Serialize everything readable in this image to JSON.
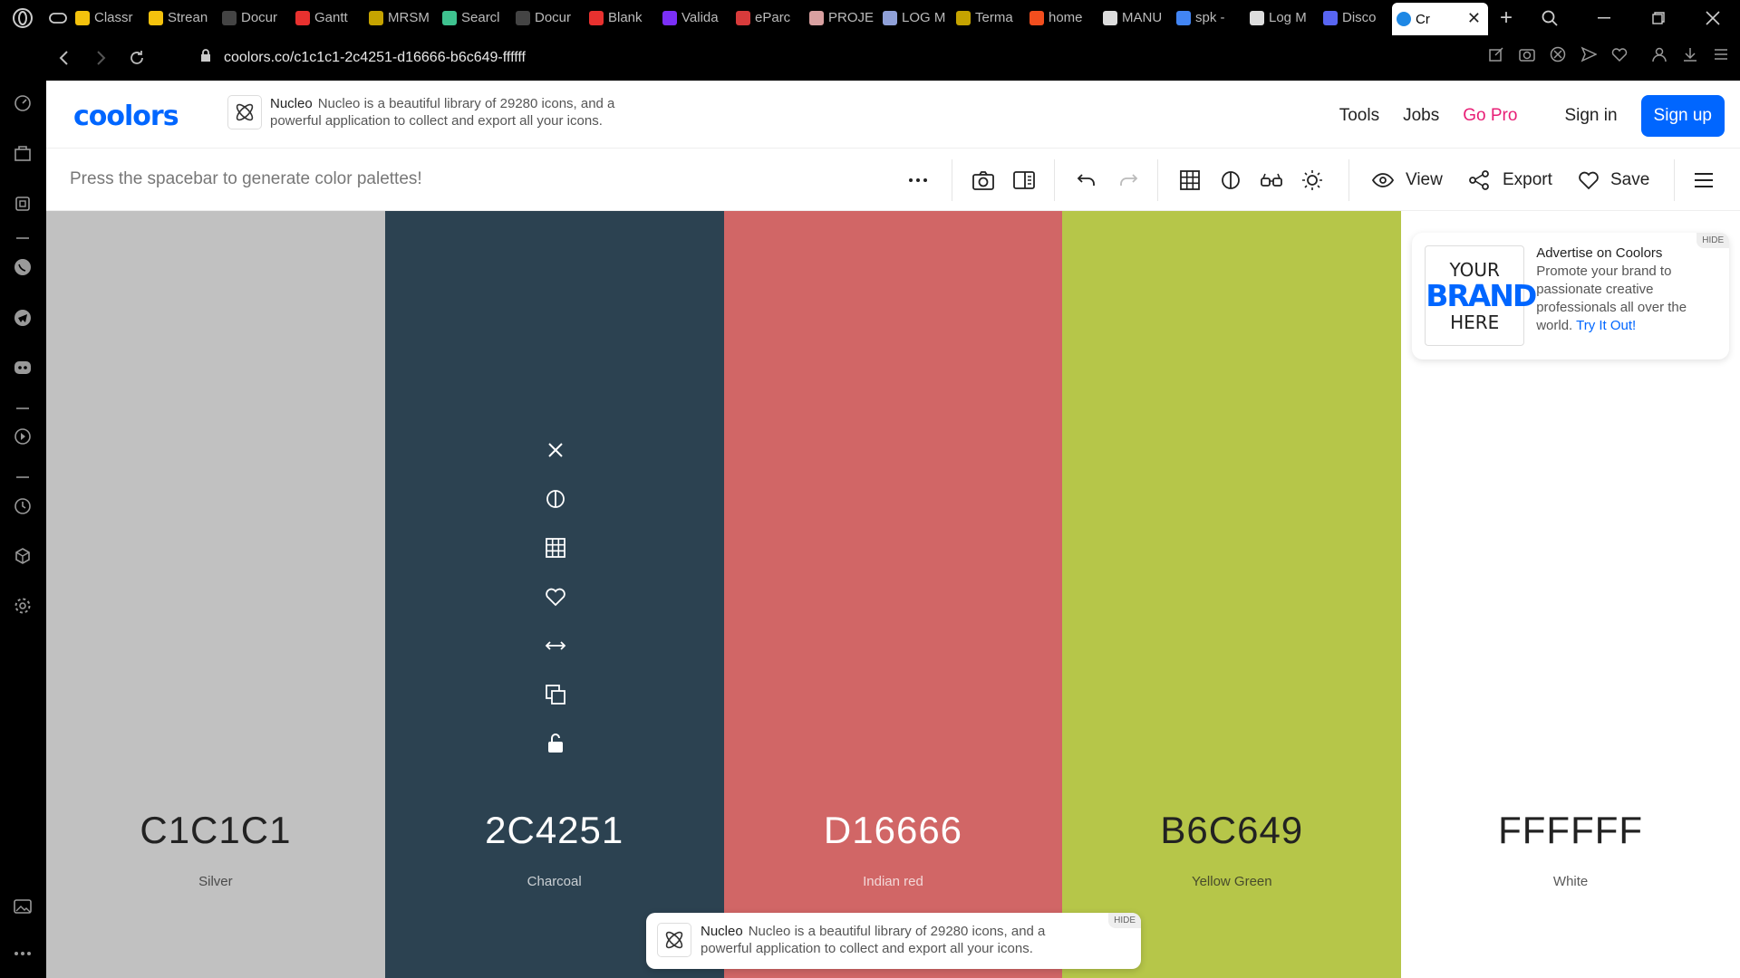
{
  "browser": {
    "tabs": [
      {
        "label": "Classr",
        "color": "#f4c20d"
      },
      {
        "label": "Strean",
        "color": "#f4c20d"
      },
      {
        "label": "Docur",
        "color": "#444444"
      },
      {
        "label": "Gantt",
        "color": "#e8312f"
      },
      {
        "label": "MRSM",
        "color": "#c5a300"
      },
      {
        "label": "Searcl",
        "color": "#3ec28f"
      },
      {
        "label": "Docur",
        "color": "#444444"
      },
      {
        "label": "Blank",
        "color": "#e8312f"
      },
      {
        "label": "Valida",
        "color": "#7b2ff7"
      },
      {
        "label": "eParc",
        "color": "#d83b3b"
      },
      {
        "label": "PROJE",
        "color": "#d9a0a0"
      },
      {
        "label": "LOG M",
        "color": "#8fa0d8"
      },
      {
        "label": "Terma",
        "color": "#c5a300"
      },
      {
        "label": "home",
        "color": "#f24e1e"
      },
      {
        "label": "MANU",
        "color": "#dddddd"
      },
      {
        "label": "spk -",
        "color": "#4285f4"
      },
      {
        "label": "Log M",
        "color": "#dddddd"
      },
      {
        "label": "Disco",
        "color": "#5865f2"
      }
    ],
    "active_tab": {
      "label": "Cr",
      "color": "#1e88e5"
    },
    "new_tab": "+",
    "url": "coolors.co/c1c1c1-2c4251-d16666-b6c649-ffffff"
  },
  "header": {
    "logo": "coolors",
    "ad": {
      "brand": "Nucleo",
      "text": "Nucleo is a beautiful library of 29280 icons, and a powerful application to collect and export all your icons."
    },
    "nav": {
      "tools": "Tools",
      "jobs": "Jobs",
      "gopro": "Go Pro",
      "signin": "Sign in",
      "signup": "Sign up"
    }
  },
  "toolbar": {
    "hint": "Press the spacebar to generate color palettes!",
    "view": "View",
    "export": "Export",
    "save": "Save"
  },
  "palette": [
    {
      "hex": "C1C1C1",
      "name": "Silver",
      "bg": "#c1c1c1",
      "fg": "#222222"
    },
    {
      "hex": "2C4251",
      "name": "Charcoal",
      "bg": "#2c4251",
      "fg": "#ffffff"
    },
    {
      "hex": "D16666",
      "name": "Indian red",
      "bg": "#d16666",
      "fg": "#ffffff"
    },
    {
      "hex": "B6C649",
      "name": "Yellow Green",
      "bg": "#b6c649",
      "fg": "#222222"
    },
    {
      "hex": "FFFFFF",
      "name": "White",
      "bg": "#ffffff",
      "fg": "#222222"
    }
  ],
  "ad_side": {
    "brand_line1": "YOUR",
    "brand_line2": "BRAND",
    "brand_line3": "HERE",
    "title": "Advertise on Coolors",
    "text": "Promote your brand to passionate creative professionals all over the world.",
    "cta": "Try It Out!",
    "hide": "HIDE"
  },
  "ad_bottom": {
    "brand": "Nucleo",
    "text": "Nucleo is a beautiful library of 29280 icons, and a powerful application to collect and export all your icons.",
    "hide": "HIDE"
  }
}
